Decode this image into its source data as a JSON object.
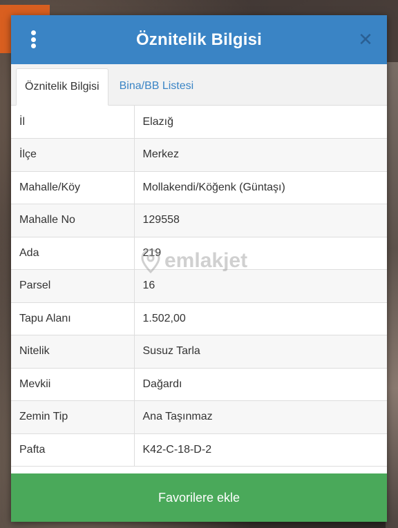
{
  "header": {
    "title": "Öznitelik Bilgisi"
  },
  "tabs": [
    {
      "label": "Öznitelik Bilgisi",
      "active": true
    },
    {
      "label": "Bina/BB Listesi",
      "active": false
    }
  ],
  "rows": [
    {
      "key": "İl",
      "value": "Elazığ"
    },
    {
      "key": "İlçe",
      "value": "Merkez"
    },
    {
      "key": "Mahalle/Köy",
      "value": "Mollakendi/Köğenk (Güntaşı)"
    },
    {
      "key": "Mahalle No",
      "value": "129558"
    },
    {
      "key": "Ada",
      "value": "219"
    },
    {
      "key": "Parsel",
      "value": "16"
    },
    {
      "key": "Tapu Alanı",
      "value": "1.502,00"
    },
    {
      "key": "Nitelik",
      "value": "Susuz Tarla"
    },
    {
      "key": "Mevkii",
      "value": "Dağardı"
    },
    {
      "key": "Zemin Tip",
      "value": "Ana Taşınmaz"
    },
    {
      "key": "Pafta",
      "value": "K42-C-18-D-2"
    }
  ],
  "watermark": {
    "text": "emlakjet"
  },
  "footer": {
    "favorite_label": "Favorilere ekle"
  },
  "colors": {
    "header": "#3a84c5",
    "favorite_button": "#4aa95a",
    "background_accent": "#d95f20"
  },
  "icons": {
    "menu": "vertical-dots-icon",
    "close": "close-icon",
    "watermark": "location-pin-icon"
  }
}
